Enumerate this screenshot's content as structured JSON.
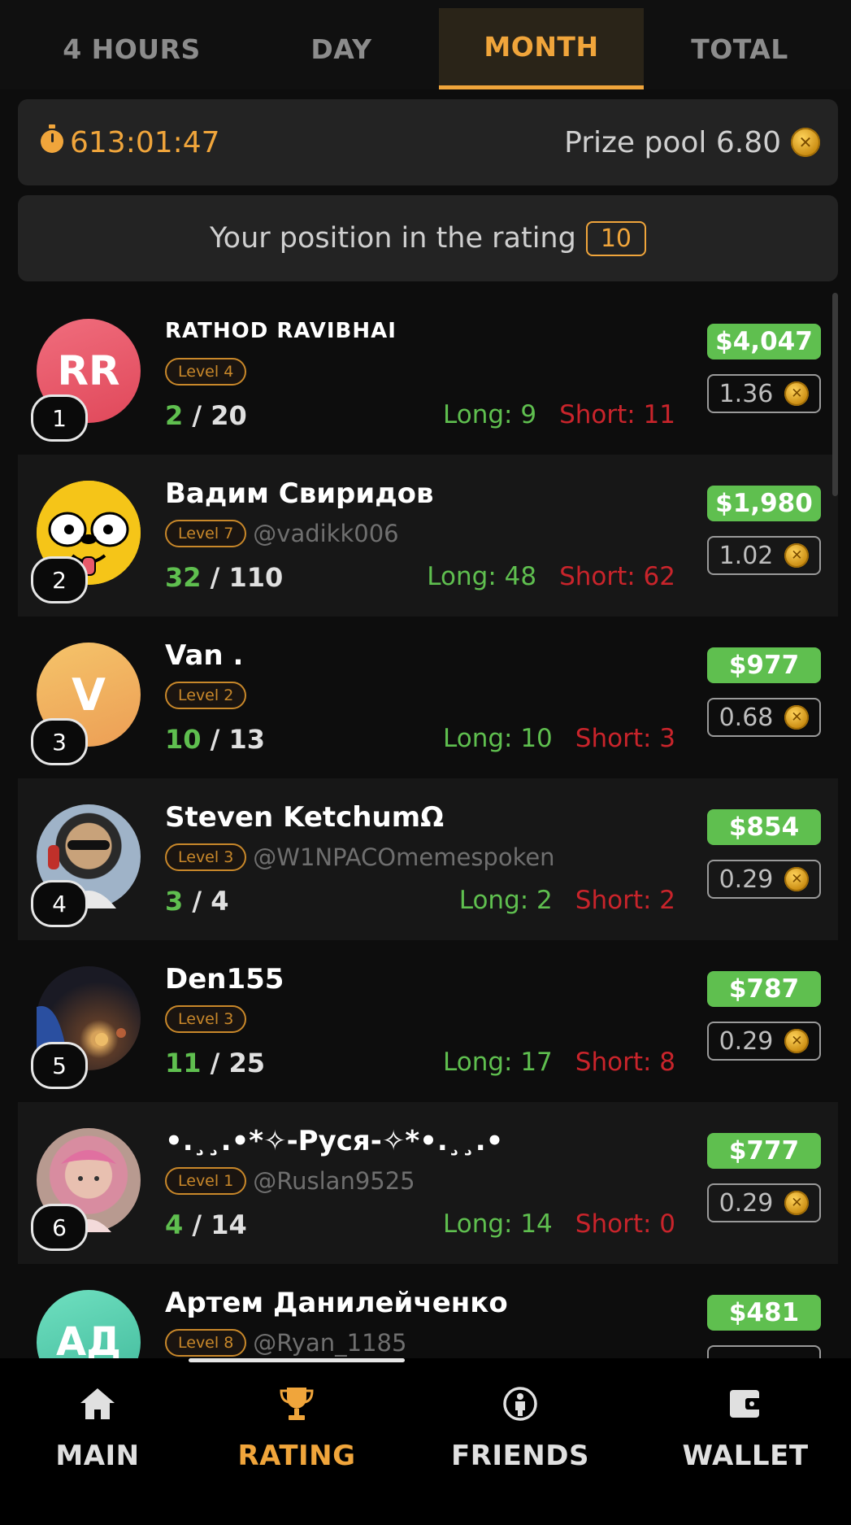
{
  "tabs": [
    {
      "label": "4 HOURS"
    },
    {
      "label": "DAY"
    },
    {
      "label": "MONTH"
    },
    {
      "label": "TOTAL"
    }
  ],
  "timer": {
    "value": "613:01:47"
  },
  "prize_pool": {
    "label": "Prize pool 6.80"
  },
  "position": {
    "label": "Your position in the rating",
    "value": "10"
  },
  "leaders": [
    {
      "rank": "1",
      "name": "RATHOD RAVIBHAI",
      "initials": "RR",
      "avatar_color": "#e85a6a",
      "level": "Level 4",
      "handle": "",
      "score_win": "2",
      "score_total": " / 20",
      "long": "Long: 9",
      "short": "Short: 11",
      "usd": "$4,047",
      "tokens": "1.36"
    },
    {
      "rank": "2",
      "name": "Вадим Свиридов",
      "initials": "",
      "avatar_color": "#f5c518",
      "level": "Level 7",
      "handle": "@vadikk006",
      "score_win": "32",
      "score_total": " / 110",
      "long": "Long: 48",
      "short": "Short: 62",
      "usd": "$1,980",
      "tokens": "1.02"
    },
    {
      "rank": "3",
      "name": "Van .",
      "initials": "V",
      "avatar_color": "#f0b860",
      "level": "Level 2",
      "handle": "",
      "score_win": "10",
      "score_total": " / 13",
      "long": "Long: 10",
      "short": "Short: 3",
      "usd": "$977",
      "tokens": "0.68"
    },
    {
      "rank": "4",
      "name": "Steven KetchumΩ",
      "initials": "",
      "avatar_color": "#6e7a8a",
      "level": "Level 3",
      "handle": "@W1NPACOmemespoken",
      "score_win": "3",
      "score_total": " / 4",
      "long": "Long: 2",
      "short": "Short: 2",
      "usd": "$854",
      "tokens": "0.29"
    },
    {
      "rank": "5",
      "name": "Den155",
      "initials": "",
      "avatar_color": "#3a2a20",
      "level": "Level 3",
      "handle": "",
      "score_win": "11",
      "score_total": " / 25",
      "long": "Long: 17",
      "short": "Short: 8",
      "usd": "$787",
      "tokens": "0.29"
    },
    {
      "rank": "6",
      "name": "•.¸¸.•*✧-Руся-✧*•.¸¸.•",
      "initials": "",
      "avatar_color": "#c89a9a",
      "level": "Level 1",
      "handle": "@Ruslan9525",
      "score_win": "4",
      "score_total": " / 14",
      "long": "Long: 14",
      "short": "Short: 0",
      "usd": "$777",
      "tokens": "0.29"
    },
    {
      "rank": "7",
      "name": "Артем Данилейченко",
      "initials": "АД",
      "avatar_color": "#5fd0b0",
      "level": "Level 8",
      "handle": "@Ryan_1185",
      "score_win": "",
      "score_total": "",
      "long": "",
      "short": "",
      "usd": "$481",
      "tokens": ""
    }
  ],
  "nav": [
    {
      "label": "MAIN",
      "icon": "home-icon"
    },
    {
      "label": "RATING",
      "icon": "trophy-icon"
    },
    {
      "label": "FRIENDS",
      "icon": "friends-icon"
    },
    {
      "label": "WALLET",
      "icon": "wallet-icon"
    }
  ],
  "colors": {
    "accent": "#f0a53b",
    "green": "#5fbf4f",
    "red": "#c9242b",
    "background": "#0d0d0d"
  }
}
